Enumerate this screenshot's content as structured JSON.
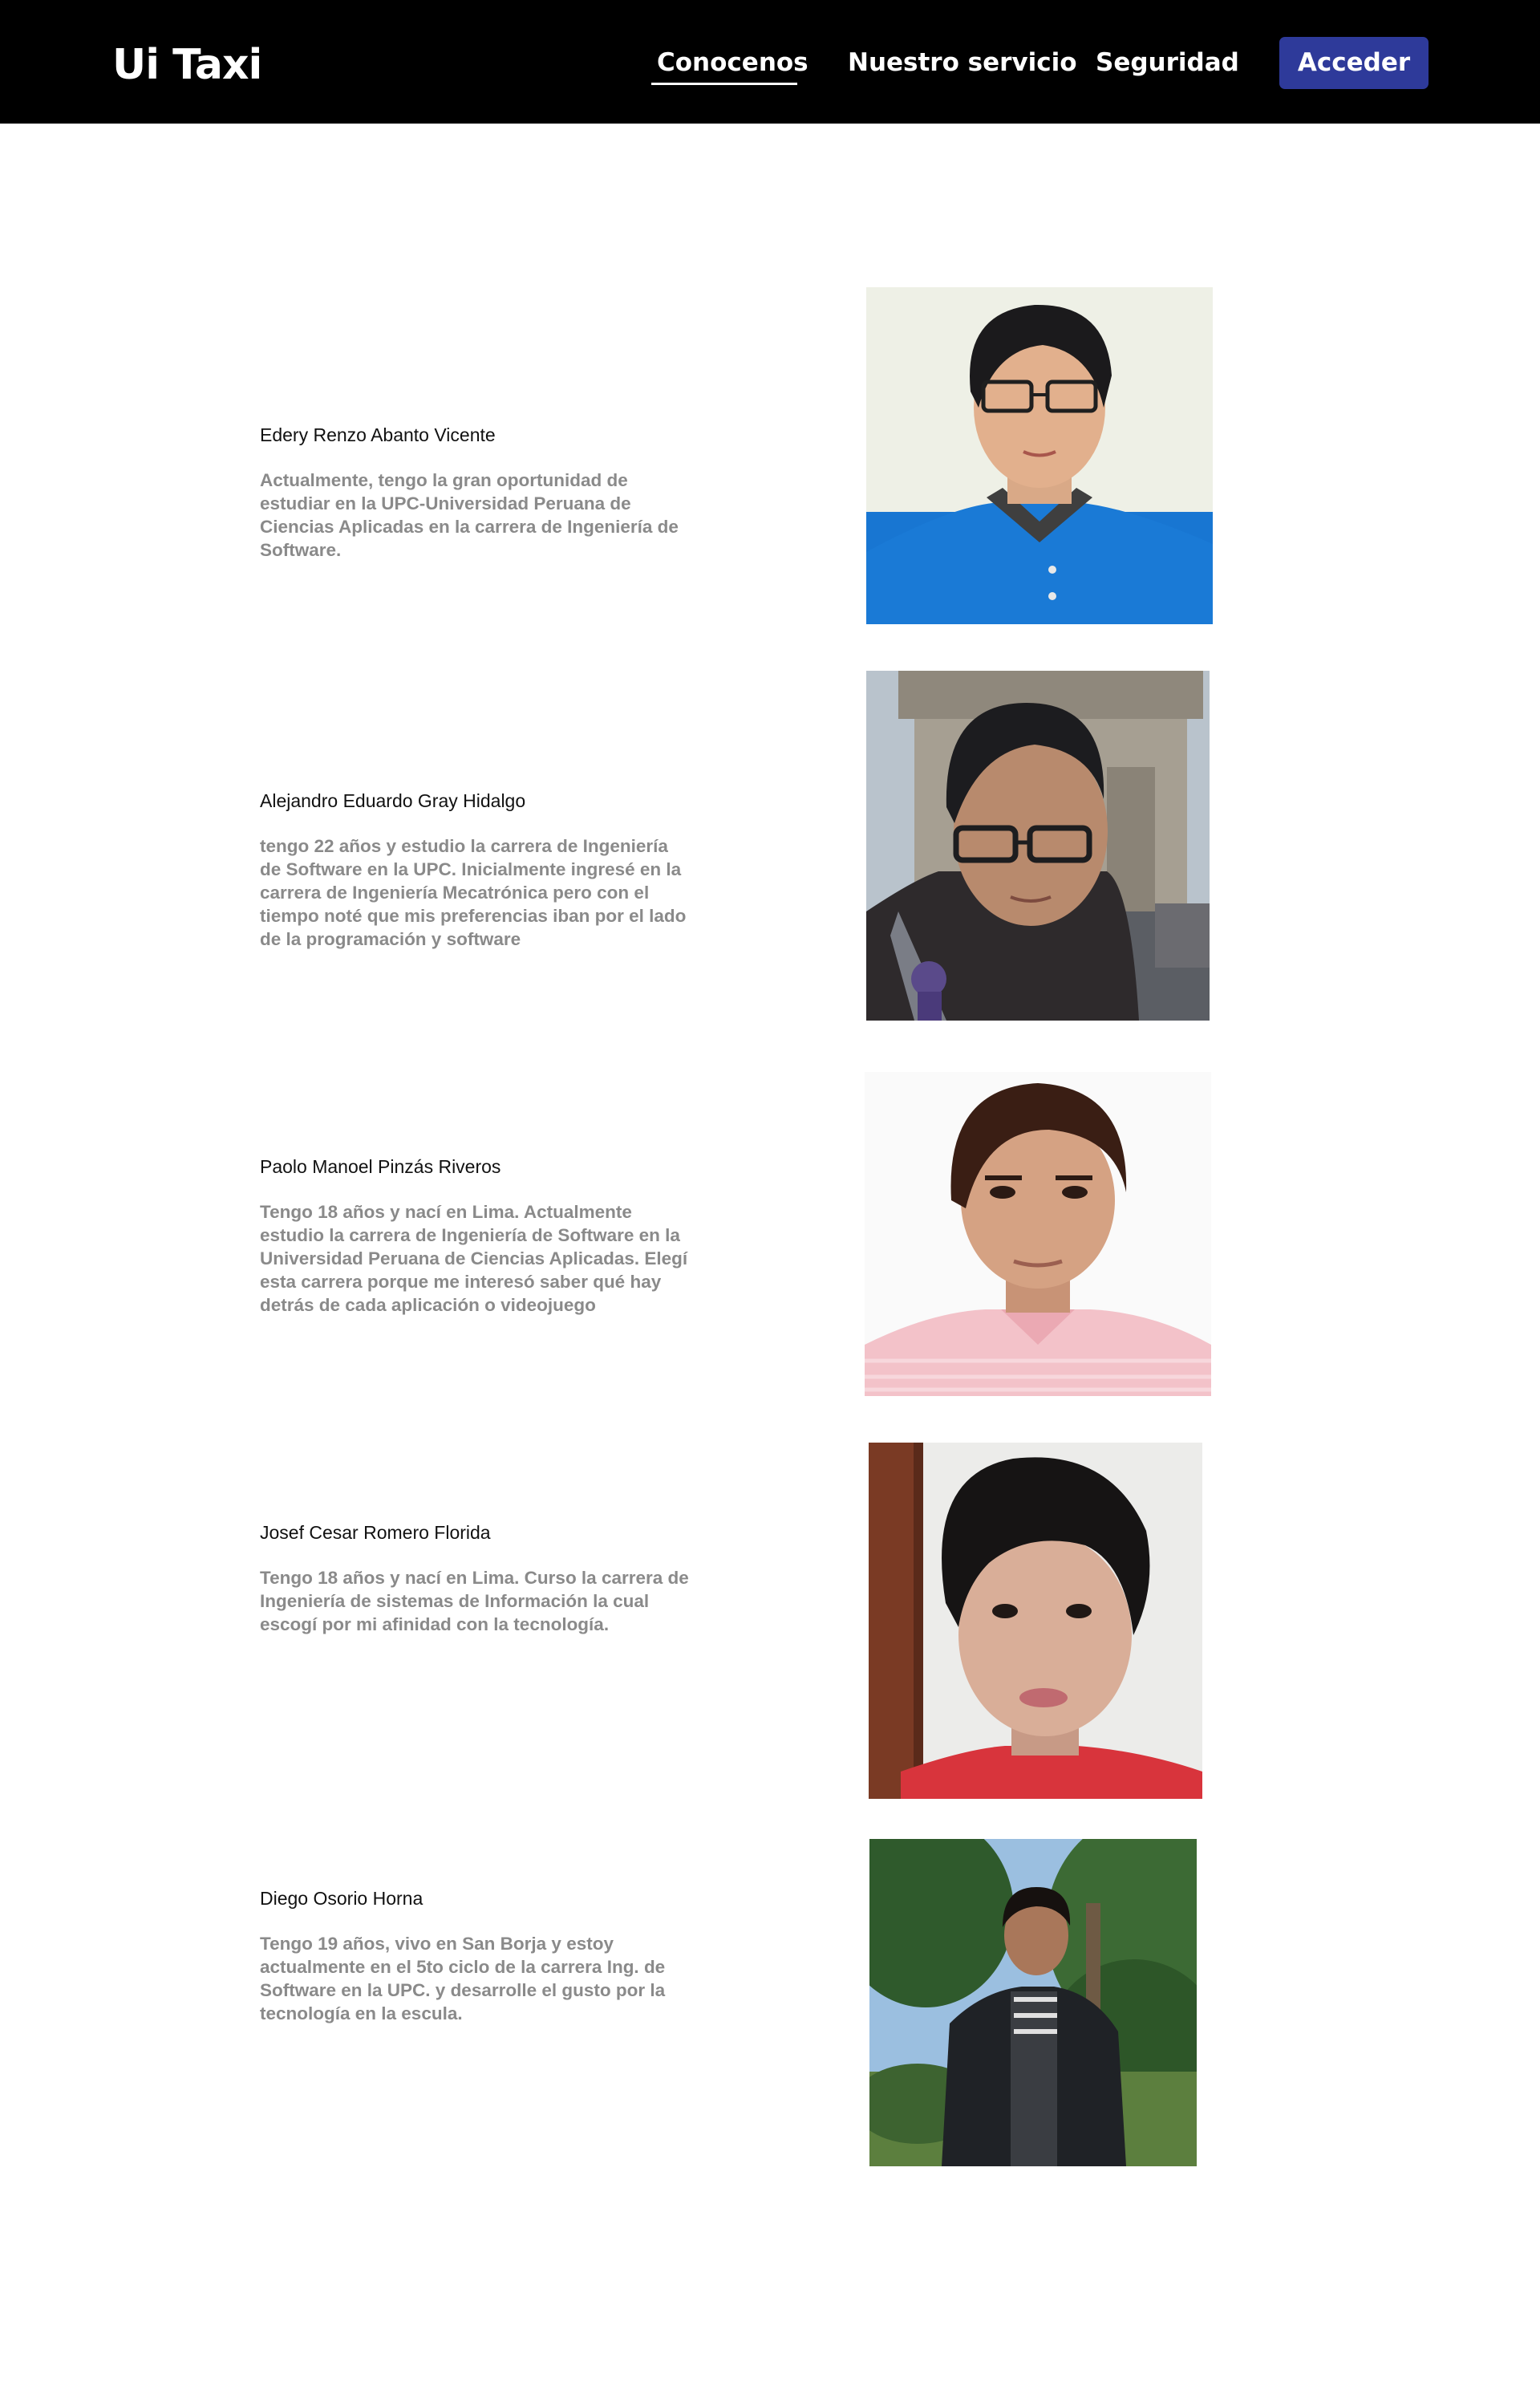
{
  "header": {
    "brand": "Ui Taxi",
    "nav": [
      {
        "label": "Conocenos",
        "active": true
      },
      {
        "label": "Nuestro servicio",
        "active": false
      },
      {
        "label": "Seguridad",
        "active": false
      }
    ],
    "login_label": "Acceder",
    "accent_color": "#2e3a9a"
  },
  "members": [
    {
      "name": "Edery Renzo Abanto Vicente",
      "bio": "Actualmente, tengo la gran oportunidad de estudiar en la UPC-Universidad Peruana de Ciencias Aplicadas en la carrera de Ingeniería de Software."
    },
    {
      "name": "Alejandro Eduardo Gray Hidalgo",
      "bio": "tengo 22 años y estudio la carrera de Ingeniería de Software en la UPC. Inicialmente ingresé en la carrera de Ingeniería Mecatrónica pero con el tiempo noté que mis preferencias iban por el lado de la programación y software"
    },
    {
      "name": "Paolo Manoel Pinzás Riveros",
      "bio": "Tengo 18 años y nací en Lima. Actualmente estudio la carrera de Ingeniería de Software en la Universidad Peruana de Ciencias Aplicadas. Elegí esta carrera porque me interesó saber qué hay detrás de cada aplicación o videojuego"
    },
    {
      "name": "Josef Cesar Romero Florida",
      "bio": "Tengo 18 años y nací en Lima. Curso la carrera de Ingeniería de sistemas de Información la cual escogí por mi afinidad con la tecnología."
    },
    {
      "name": "Diego Osorio Horna",
      "bio": "Tengo 19 años, vivo en San Borja y estoy actualmente en el 5to ciclo de la carrera Ing. de Software en la UPC. y desarrolle el gusto por la tecnología en la escula."
    }
  ]
}
